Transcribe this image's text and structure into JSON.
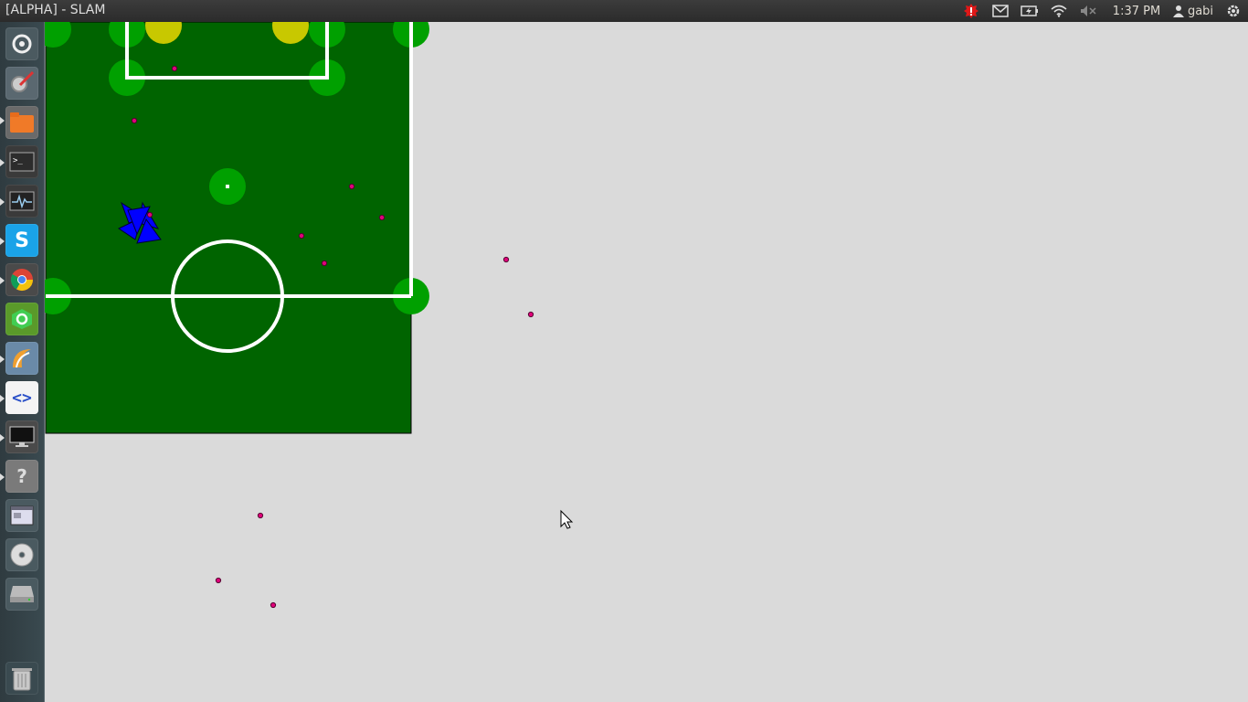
{
  "window": {
    "title": "[ALPHA] - SLAM"
  },
  "panel": {
    "clock": "1:37 PM",
    "user": "gabi",
    "icons": [
      "update-alert-icon",
      "mail-icon",
      "battery-icon",
      "wifi-icon",
      "volume-muted-icon",
      "user-icon",
      "session-gear-icon"
    ]
  },
  "launcher": {
    "items": [
      {
        "name": "dash-home-icon"
      },
      {
        "name": "system-settings-icon"
      },
      {
        "name": "files-icon"
      },
      {
        "name": "terminal-icon"
      },
      {
        "name": "system-monitor-icon"
      },
      {
        "name": "skype-icon"
      },
      {
        "name": "chrome-icon"
      },
      {
        "name": "qt-creator-icon"
      },
      {
        "name": "wireshark-icon"
      },
      {
        "name": "code-editor-icon"
      },
      {
        "name": "display-icon"
      },
      {
        "name": "unknown-app-icon"
      },
      {
        "name": "window-app-icon"
      },
      {
        "name": "optical-disc-icon"
      },
      {
        "name": "drive-icon"
      },
      {
        "name": "trash-icon"
      }
    ]
  },
  "colors": {
    "field": "#006400",
    "landmark": "#00a000",
    "goal_post": "#c8c800",
    "particle": "#e0007a",
    "robot": "#0000ff",
    "line": "#ffffff",
    "background": "#dadada"
  }
}
